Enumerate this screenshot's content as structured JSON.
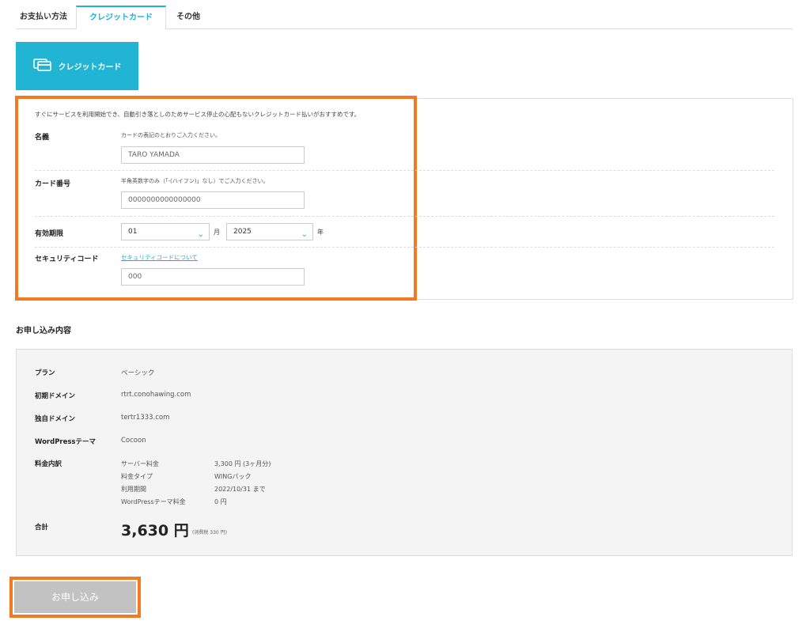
{
  "tabs": [
    {
      "label": "お支払い方法"
    },
    {
      "label": "クレジットカード"
    },
    {
      "label": "その他"
    }
  ],
  "payment_method": {
    "label": "クレジットカード",
    "icon": "credit-card-icon"
  },
  "form": {
    "intro": "すぐにサービスを利用開始でき、自動引き落としのためサービス停止の心配もないクレジットカード払いがおすすめです。",
    "name": {
      "label": "名義",
      "hint": "カードの表記のとおりご入力ください。",
      "value": "TARO YAMADA"
    },
    "card_number": {
      "label": "カード番号",
      "hint": "半角英数字のみ（「-(ハイフン)」なし）でご入力ください。",
      "value": "0000000000000000"
    },
    "expiry": {
      "label": "有効期限",
      "month": "01",
      "month_unit": "月",
      "year": "2025",
      "year_unit": "年"
    },
    "security": {
      "label": "セキュリティコード",
      "link": "セキュリティコードについて",
      "value": "000"
    }
  },
  "summary": {
    "title": "お申し込み内容",
    "plan": {
      "label": "プラン",
      "value": "ベーシック"
    },
    "initial_domain": {
      "label": "初期ドメイン",
      "value": "rtrt.conohawing.com"
    },
    "own_domain": {
      "label": "独自ドメイン",
      "value": "tertr1333.com"
    },
    "theme": {
      "label": "WordPressテーマ",
      "value": "Cocoon"
    },
    "fees": {
      "label": "料金内訳",
      "rows": [
        {
          "name": "サーバー料金",
          "value": "3,300 円 (3ヶ月分)"
        },
        {
          "name": "料金タイプ",
          "value": "WINGパック"
        },
        {
          "name": "利用期間",
          "value": "2022/10/31 まで"
        },
        {
          "name": "WordPressテーマ料金",
          "value": "0 円"
        }
      ]
    },
    "total": {
      "label": "合計",
      "value": "3,630 円",
      "tax": "(消費税 330 円)"
    }
  },
  "submit_label": "お申し込み",
  "colors": {
    "accent": "#1cb1d3",
    "highlight": "#f47920",
    "submit_bg": "#c2c2c2"
  }
}
